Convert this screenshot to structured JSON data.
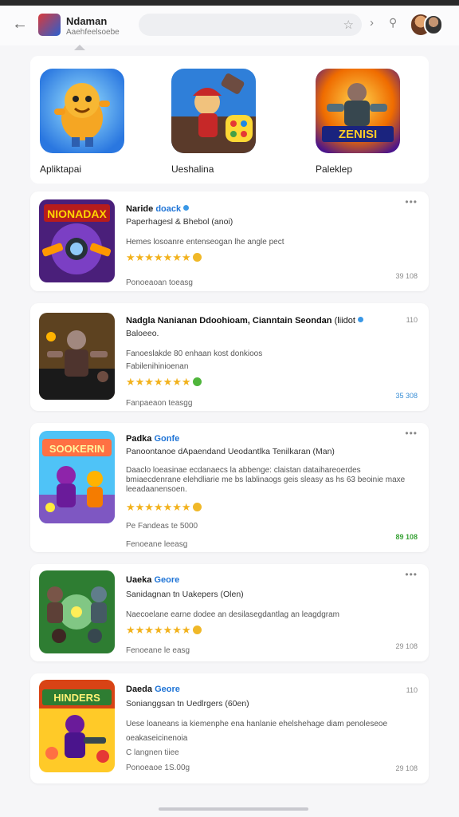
{
  "header": {
    "app_title": "Ndaman",
    "app_subtitle": "Aaehfeelsoebe"
  },
  "featured": [
    {
      "label": "Apliktapai"
    },
    {
      "label": "Ueshalina"
    },
    {
      "label": "Paleklep",
      "tile_text": "ZENISI"
    }
  ],
  "cards": [
    {
      "thumb_text": "NIONADAX",
      "title": "Naride",
      "title_tag": "doack",
      "subtitle": "Paperhagesl & Bhebol (anoi)",
      "desc": "Hemes losoanre entenseogan lhe angle pect",
      "footer": "Ponoeaoan toeasg",
      "meta": "39 108"
    },
    {
      "title": "Nadgla Nanianan Ddoohioam, Cianntain Seondan",
      "title_tag": "(liidot",
      "subtitle": "Baloeeo.",
      "desc": "Fanoeslakde  80  enhaan kost donkioos",
      "desc2": "Fabilenihinioenan",
      "footer": "Fanpaeaon teasgg",
      "meta": "35 308",
      "meta_corner": "110"
    },
    {
      "thumb_text": "SOOKERIN",
      "title": "Padka",
      "title_tag": "Gonfe",
      "subtitle": "Panoontanoe dApaendand Ueodantlka Tenilkaran (Man)",
      "desc": "Daaclo loeasinae ecdanaecs la abbenge: claistan dataihareoerdes bmiaecdenrane elehdliarie me bs lablinaogs geis sleasy as hs 63 beoinie maxe leeadaanensoen.",
      "price": "Pe Fandeas te 5000",
      "footer": "Fenoeane leeasg",
      "meta": "89 108"
    },
    {
      "title": "Uaeka",
      "title_tag": "Geore",
      "subtitle": "Sanidagnan tn Uakepers (Olen)",
      "desc": "Naecoelane earne dodee an desilasegdantlag an leagdgram",
      "footer": "Fenoeane le easg",
      "meta": "29 108"
    },
    {
      "thumb_text": "HINDERS",
      "title": "Daeda",
      "title_tag": "Geore",
      "subtitle": "Sonianggsan tn Uedlrgers (60en)",
      "desc": "Uese loaneans ia kiemenphe ena hanlanie ehelshehage diam penoleseoe",
      "desc2": "oeakaseicinenoia",
      "extra": "C langnen tiiee",
      "footer": "Ponoeaoe 1S.00g",
      "meta": "29 108",
      "meta_corner": "110"
    }
  ]
}
